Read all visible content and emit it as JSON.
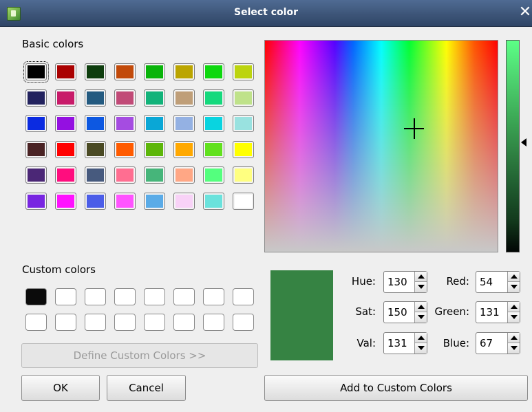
{
  "window": {
    "title": "Select color",
    "close_glyph": "✕"
  },
  "basic_colors": {
    "label": "Basic colors",
    "swatches": [
      "#000000",
      "#aa0000",
      "#0d3d0d",
      "#c24a0a",
      "#09b40a",
      "#bba500",
      "#0ed80f",
      "#bcd40f",
      "#22225e",
      "#c81a69",
      "#235a80",
      "#c14a77",
      "#12b37a",
      "#bf9e78",
      "#15d97d",
      "#bfe28a",
      "#0b2be1",
      "#9410e1",
      "#0d58e1",
      "#a54ce1",
      "#0aa7d6",
      "#94b1e3",
      "#09d4e0",
      "#99e2e0",
      "#4a2324",
      "#ff0000",
      "#4a4a24",
      "#ff5b00",
      "#5db60a",
      "#ffa800",
      "#61e11e",
      "#ffff00",
      "#4b2776",
      "#ff0d7e",
      "#475a7e",
      "#ff6e91",
      "#46b57a",
      "#ffa785",
      "#54ff7e",
      "#ffff80",
      "#7825e1",
      "#ff10ff",
      "#4b5de8",
      "#ff53ff",
      "#5aabe7",
      "#f8d2f7",
      "#6ae2dc",
      "#ffffff"
    ]
  },
  "custom_colors": {
    "label": "Custom colors",
    "swatches": [
      "#0b0b0b",
      "#ffffff",
      "#ffffff",
      "#ffffff",
      "#ffffff",
      "#ffffff",
      "#ffffff",
      "#ffffff",
      "#ffffff",
      "#ffffff",
      "#ffffff",
      "#ffffff",
      "#ffffff",
      "#ffffff",
      "#ffffff",
      "#ffffff"
    ]
  },
  "buttons": {
    "define_custom": "Define Custom Colors >>",
    "ok": "OK",
    "cancel": "Cancel",
    "add_custom": "Add to Custom Colors"
  },
  "current_color": "#368343",
  "fields": {
    "hue": {
      "label": "Hue:",
      "value": "130"
    },
    "sat": {
      "label": "Sat:",
      "value": "150"
    },
    "val": {
      "label": "Val:",
      "value": "131"
    },
    "red": {
      "label": "Red:",
      "value": "54"
    },
    "green": {
      "label": "Green:",
      "value": "131"
    },
    "blue": {
      "label": "Blue:",
      "value": "67"
    }
  }
}
